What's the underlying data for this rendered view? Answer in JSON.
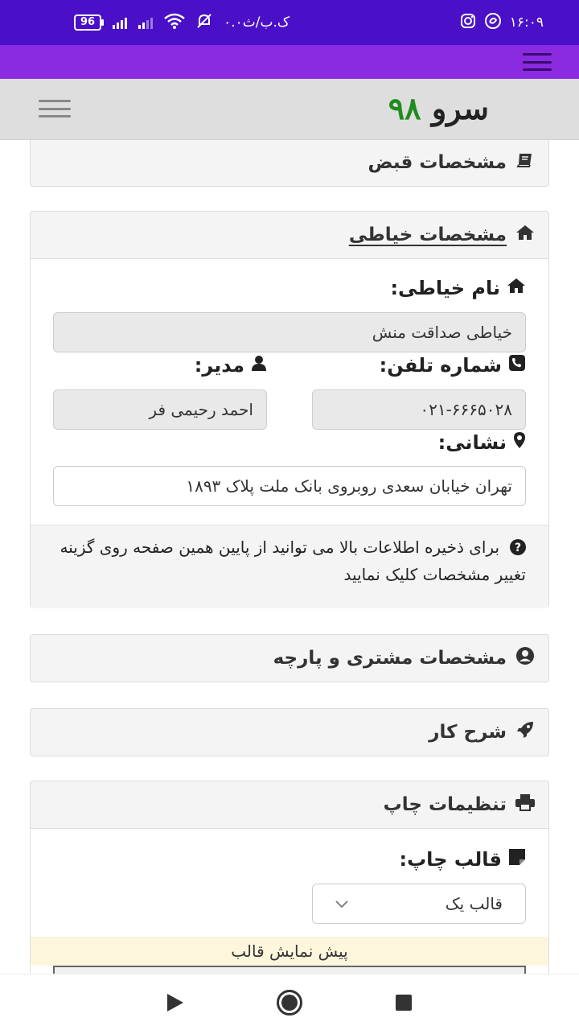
{
  "status_bar": {
    "battery": "96",
    "network_text": "۰.۰ک.ب/ث",
    "time": "۱۶:۰۹"
  },
  "header": {
    "brand_word": "سرو",
    "brand_number": "۹۸"
  },
  "sections": {
    "receipt": {
      "title": "مشخصات قبض"
    },
    "tailor": {
      "title": "مشخصات خیاطی",
      "name_label": "نام خیاطی:",
      "name_value": "خیاطی صداقت منش",
      "phone_label": "شماره تلفن:",
      "phone_value": "۰۲۱-۶۶۶۵۰۲۸",
      "manager_label": "مدیر:",
      "manager_value": "احمد رحیمی فر",
      "address_label": "نشانی:",
      "address_value": "تهران خیابان سعدی روبروی بانک ملت پلاک ۱۸۹۳",
      "help_text": "برای ذخیره اطلاعات بالا می توانید از پایین همین صفحه روی گزینه تغییر مشخصات کلیک نمایید"
    },
    "customer": {
      "title": "مشخصات مشتری و پارچه"
    },
    "job": {
      "title": "شرح کار"
    },
    "print": {
      "title": "تنظیمات چاپ",
      "template_label": "قالب چاپ:",
      "template_selected": "قالب یک",
      "preview_label": "پیش نمایش قالب"
    }
  },
  "icons": {
    "receipt": "book-icon",
    "tailor": "home-icon",
    "phone": "phone-icon",
    "manager": "user-icon",
    "address": "map-marker-icon",
    "help": "question-circle-icon",
    "customer": "user-circle-icon",
    "job": "rocket-icon",
    "print": "print-icon",
    "template": "sticky-note-icon"
  },
  "colors": {
    "status_bar": "#4a10c7",
    "top_nav": "#8a2be2",
    "brand_number": "#1e8c1e"
  }
}
